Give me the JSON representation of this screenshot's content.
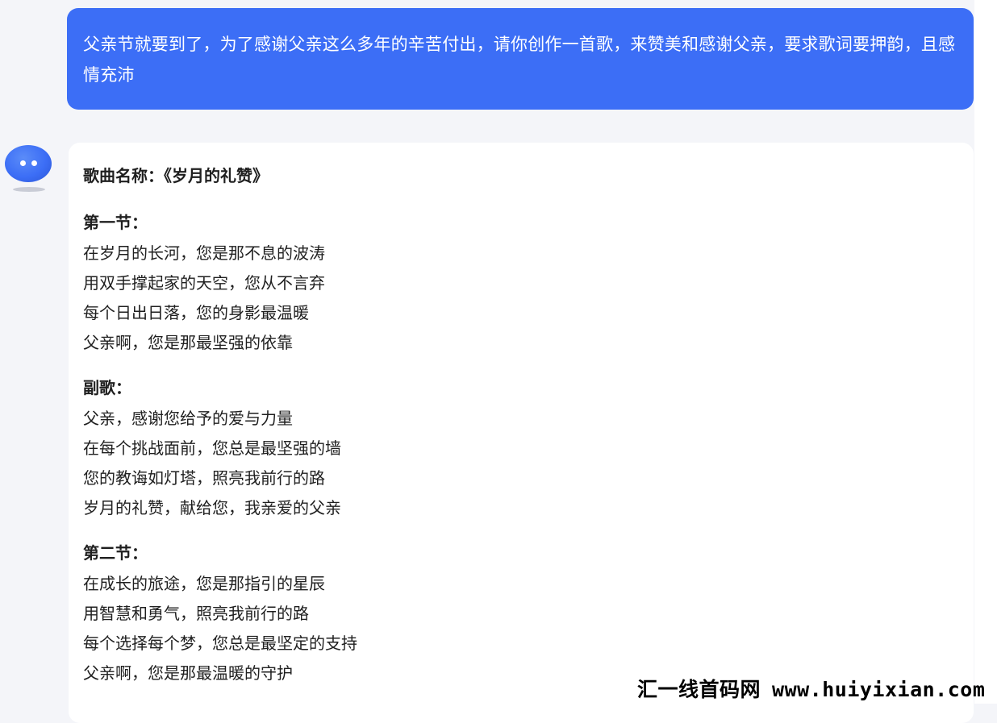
{
  "user_message": {
    "text": "父亲节就要到了，为了感谢父亲这么多年的辛苦付出，请你创作一首歌，来赞美和感谢父亲，要求歌词要押韵，且感情充沛"
  },
  "bot_message": {
    "title": "歌曲名称：《岁月的礼赞》",
    "sections": [
      {
        "heading": "第一节：",
        "lines": [
          "在岁月的长河，您是那不息的波涛",
          "用双手撑起家的天空，您从不言弃",
          "每个日出日落，您的身影最温暖",
          "父亲啊，您是那最坚强的依靠"
        ]
      },
      {
        "heading": "副歌：",
        "lines": [
          "父亲，感谢您给予的爱与力量",
          "在每个挑战面前，您总是最坚强的墙",
          "您的教诲如灯塔，照亮我前行的路",
          "岁月的礼赞，献给您，我亲爱的父亲"
        ]
      },
      {
        "heading": "第二节：",
        "lines": [
          "在成长的旅途，您是那指引的星辰",
          "用智慧和勇气，照亮我前行的路",
          "每个选择每个梦，您总是最坚定的支持",
          "父亲啊，您是那最温暖的守护"
        ]
      }
    ]
  },
  "watermark": {
    "brand": "汇一线首码网",
    "url": "www.huiyixian.com"
  },
  "colors": {
    "user_bubble_bg": "#3c6ef6",
    "page_bg": "#f4f5f9",
    "card_bg": "#ffffff"
  },
  "icons": {
    "avatar": "bot-avatar-icon"
  }
}
